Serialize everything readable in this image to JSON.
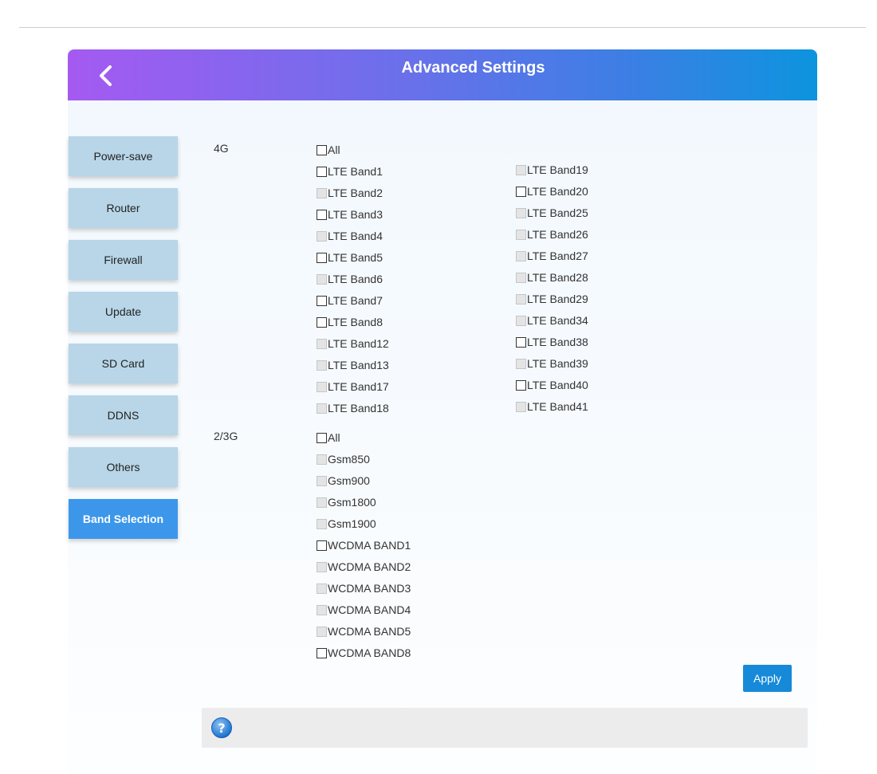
{
  "header": {
    "title": "Advanced Settings",
    "back_icon": "chevron-left-icon"
  },
  "menu": {
    "items": [
      {
        "label": "Power-save",
        "active": false
      },
      {
        "label": "Router",
        "active": false
      },
      {
        "label": "Firewall",
        "active": false
      },
      {
        "label": "Update",
        "active": false
      },
      {
        "label": "SD Card",
        "active": false
      },
      {
        "label": "DDNS",
        "active": false
      },
      {
        "label": "Others",
        "active": false
      },
      {
        "label": "Band Selection",
        "active": true
      }
    ]
  },
  "lte": {
    "label": "4G",
    "all": {
      "label": "All",
      "checked": false,
      "enabled": true
    },
    "col1": [
      {
        "label": "LTE Band1",
        "enabled": true
      },
      {
        "label": "LTE Band2",
        "enabled": false
      },
      {
        "label": "LTE Band3",
        "enabled": true
      },
      {
        "label": "LTE Band4",
        "enabled": false
      },
      {
        "label": "LTE Band5",
        "enabled": true
      },
      {
        "label": "LTE Band6",
        "enabled": false
      },
      {
        "label": "LTE Band7",
        "enabled": true
      },
      {
        "label": "LTE Band8",
        "enabled": true
      },
      {
        "label": "LTE Band12",
        "enabled": false
      },
      {
        "label": "LTE Band13",
        "enabled": false
      },
      {
        "label": "LTE Band17",
        "enabled": false
      },
      {
        "label": "LTE Band18",
        "enabled": false
      }
    ],
    "col2": [
      {
        "label": "LTE Band19",
        "enabled": false
      },
      {
        "label": "LTE Band20",
        "enabled": true
      },
      {
        "label": "LTE Band25",
        "enabled": false
      },
      {
        "label": "LTE Band26",
        "enabled": false
      },
      {
        "label": "LTE Band27",
        "enabled": false
      },
      {
        "label": "LTE Band28",
        "enabled": false
      },
      {
        "label": "LTE Band29",
        "enabled": false
      },
      {
        "label": "LTE Band34",
        "enabled": false
      },
      {
        "label": "LTE Band38",
        "enabled": true
      },
      {
        "label": "LTE Band39",
        "enabled": false
      },
      {
        "label": "LTE Band40",
        "enabled": true
      },
      {
        "label": "LTE Band41",
        "enabled": false
      }
    ]
  },
  "gsm": {
    "label": "2/3G",
    "all": {
      "label": "All",
      "checked": false,
      "enabled": true
    },
    "items": [
      {
        "label": "Gsm850",
        "enabled": false
      },
      {
        "label": "Gsm900",
        "enabled": false
      },
      {
        "label": "Gsm1800",
        "enabled": false
      },
      {
        "label": "Gsm1900",
        "enabled": false
      },
      {
        "label": "WCDMA BAND1",
        "enabled": true
      },
      {
        "label": "WCDMA BAND2",
        "enabled": false
      },
      {
        "label": "WCDMA BAND3",
        "enabled": false
      },
      {
        "label": "WCDMA BAND4",
        "enabled": false
      },
      {
        "label": "WCDMA BAND5",
        "enabled": false
      },
      {
        "label": "WCDMA BAND8",
        "enabled": true
      }
    ]
  },
  "actions": {
    "apply_label": "Apply"
  },
  "help": {
    "icon": "help-icon"
  }
}
